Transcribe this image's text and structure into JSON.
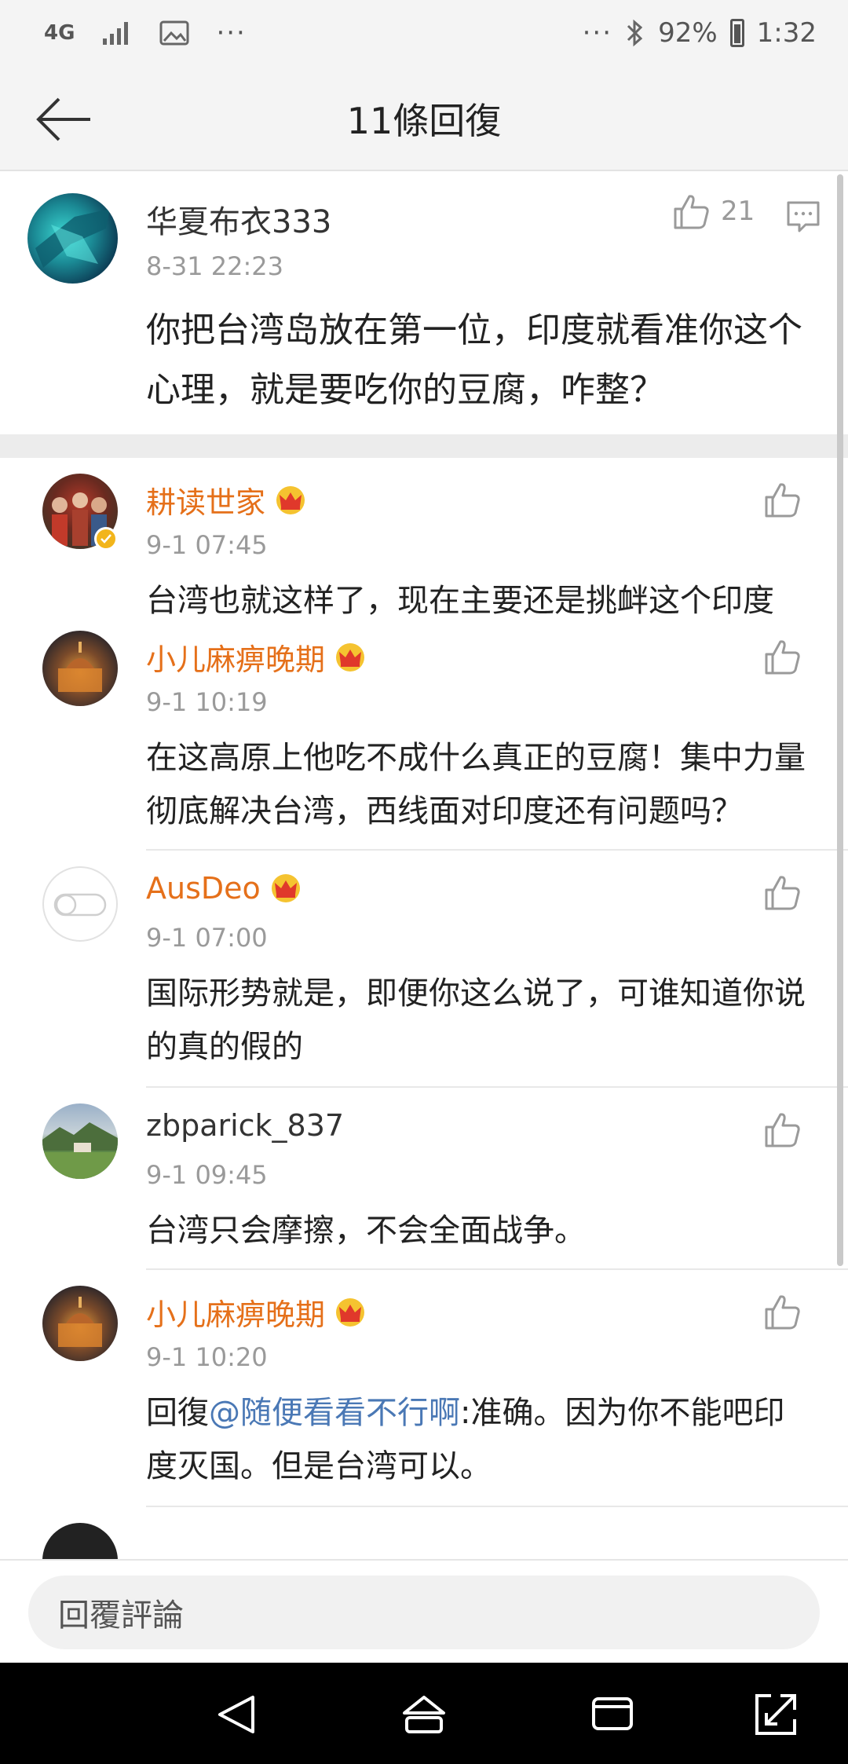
{
  "status_bar": {
    "network": "4G",
    "overflow_left": "···",
    "overflow_right": "···",
    "battery": "92%",
    "time": "1:32"
  },
  "header": {
    "title": "11條回復"
  },
  "main_comment": {
    "author": "华夏布衣333",
    "time": "8-31 22:23",
    "likes": "21",
    "text": "你把台湾岛放在第一位，印度就看准你这个心理，就是要吃你的豆腐，咋整？"
  },
  "replies": [
    {
      "author": "耕读世家",
      "vip": true,
      "verified": true,
      "time": "9-1 07:45",
      "text": "台湾也就这样了，现在主要还是挑衅这个印度"
    },
    {
      "author": "小儿麻痹晚期",
      "vip": true,
      "time": "9-1 10:19",
      "text": "在这高原上他吃不成什么真正的豆腐！集中力量彻底解决台湾，西线面对印度还有问题吗？"
    },
    {
      "author": "AusDeo",
      "vip": true,
      "time": "9-1 07:00",
      "text": "国际形势就是，即便你这么说了，可谁知道你说的真的假的"
    },
    {
      "author": "zbparick_837",
      "vip": false,
      "time": "9-1 09:45",
      "text": "台湾只会摩擦，不会全面战争。"
    },
    {
      "author": "小儿麻痹晚期",
      "vip": true,
      "time": "9-1 10:20",
      "text_prefix": "回復",
      "mention": "@随便看看不行啊",
      "text_suffix": ":准确。因为你不能吧印度灭国。但是台湾可以。"
    }
  ],
  "input": {
    "placeholder": "回覆評論"
  },
  "colors": {
    "vip_name": "#e5701a",
    "mention": "#4a78b5",
    "muted": "#9a9a9a"
  },
  "icons": [
    "back-arrow-icon",
    "thumbs-up-icon",
    "comment-icon",
    "crown-icon",
    "nav-back-icon",
    "nav-home-icon",
    "nav-recents-icon",
    "nav-rotate-icon"
  ]
}
